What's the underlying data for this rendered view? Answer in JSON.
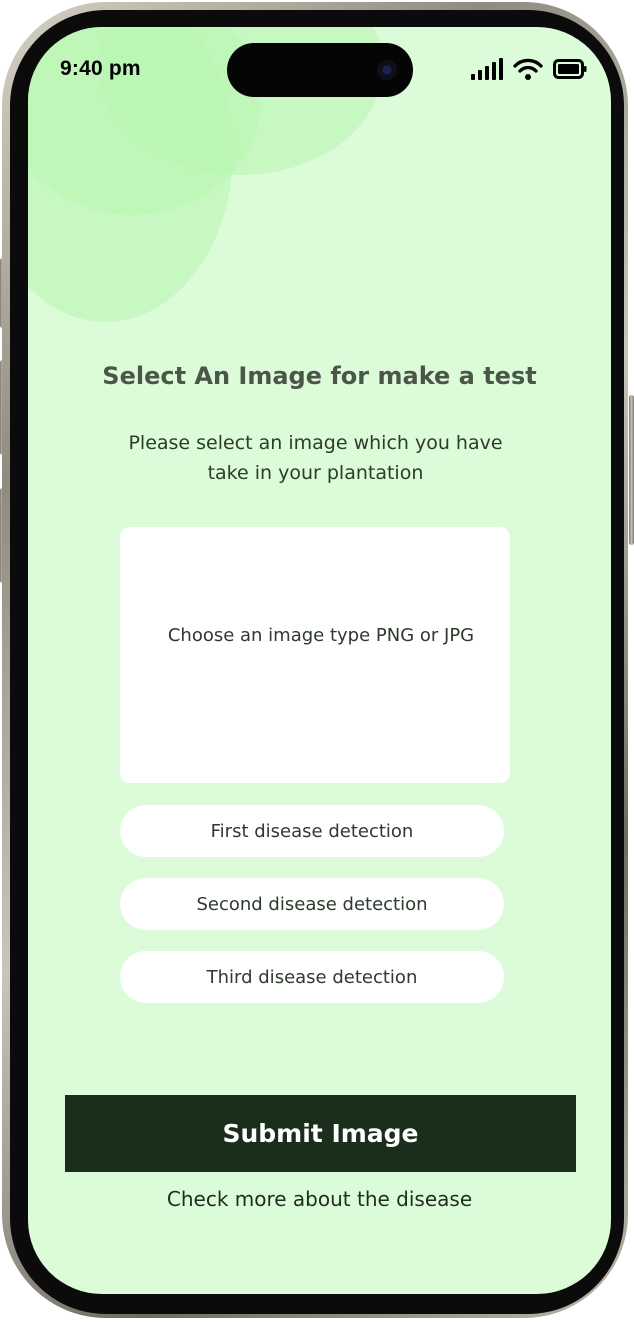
{
  "status_bar": {
    "time": "9:40 pm",
    "icons": [
      "signal-icon",
      "wifi-icon",
      "battery-icon"
    ]
  },
  "page": {
    "title": "Select An Image for make a test",
    "subtitle": "Please select an image which you have take in your plantation",
    "upload_prompt": "Choose an image type PNG or JPG",
    "options": [
      {
        "label": "First disease detection"
      },
      {
        "label": "Second disease detection"
      },
      {
        "label": "Third disease detection"
      }
    ],
    "submit_label": "Submit Image",
    "more_link": "Check more about the disease"
  },
  "colors": {
    "background": "#dcfbd8",
    "accent_blob": "#b7f5b1",
    "title": "#4a5648",
    "button_dark": "#1a2e1b",
    "card": "#ffffff"
  }
}
